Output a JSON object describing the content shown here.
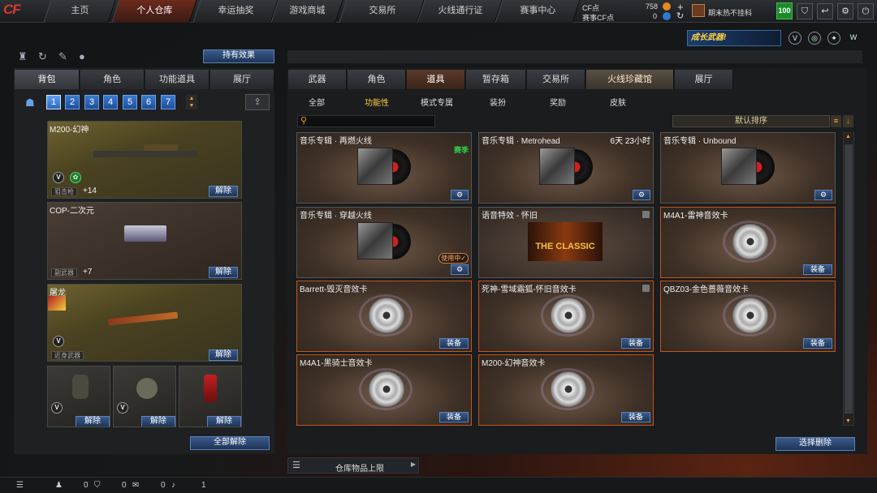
{
  "topnav": {
    "logo": "CF",
    "tabs": [
      "主页",
      "个人仓库",
      "幸运抽奖",
      "游戏商城",
      "交易所",
      "火线通行证",
      "赛事中心"
    ],
    "active_tab": 1,
    "cf_label": "CF点",
    "cf_value": "758",
    "tradecf_label": "赛事CF点",
    "tradecf_value": "0",
    "plus": "+",
    "clan": "期末热不挂科",
    "level": "100"
  },
  "banner": {
    "text": "成长武器!"
  },
  "left": {
    "effect_button": "持有效果",
    "tabs": [
      "背包",
      "角色",
      "功能道具",
      "展厅"
    ],
    "pages": [
      "1",
      "2",
      "3",
      "4",
      "5",
      "6",
      "7"
    ],
    "slots": [
      {
        "name": "M200-幻神",
        "type": "狙击枪",
        "bonus": "+14",
        "button": "解除"
      },
      {
        "name": "COP-二次元",
        "type": "副武器",
        "bonus": "+7",
        "button": "解除"
      },
      {
        "name": "屠龙",
        "type": "近身武器",
        "bonus": "",
        "button": "解除"
      }
    ],
    "grenades": [
      {
        "button": "解除"
      },
      {
        "button": "解除"
      },
      {
        "button": "解除"
      }
    ],
    "unequip_all": "全部解除"
  },
  "right": {
    "tabs": [
      "武器",
      "角色",
      "道具",
      "暂存箱",
      "交易所",
      "火线珍藏馆",
      "展厅"
    ],
    "active_tab": 2,
    "selected_tab": 5,
    "subtabs": [
      "全部",
      "功能性",
      "模式专属",
      "装扮",
      "奖励",
      "皮肤"
    ],
    "active_subtab": 1,
    "sort": "默认排序",
    "cards": [
      {
        "name": "音乐专辑 · 再燃火线",
        "kind": "album",
        "tag": "赛季",
        "tag_color": "#2fd04a",
        "button": "⚙"
      },
      {
        "name": "音乐专辑 · Metrohead",
        "kind": "album",
        "tag": "6天 23小时",
        "tag_color": "#ffffff",
        "button": "⚙"
      },
      {
        "name": "音乐专辑 · Unbound",
        "kind": "album",
        "tag": "",
        "button": "⚙"
      },
      {
        "name": "音乐专辑 · 穿越火线",
        "kind": "album",
        "tag": "使用中✓",
        "tag_color": "#ffb070",
        "button": "⚙"
      },
      {
        "name": "语音特效 - 怀旧",
        "kind": "classic",
        "art": "THE CLASSIC",
        "tag": "",
        "button": ""
      },
      {
        "name": "M4A1-雷神音效卡",
        "kind": "disc",
        "tag": "",
        "button": "装备"
      },
      {
        "name": "Barrett-毁灭音效卡",
        "kind": "disc",
        "tag": "",
        "button": "装备"
      },
      {
        "name": "死神-雪域霜狐-怀旧音效卡",
        "kind": "disc",
        "tag": "",
        "button": "装备"
      },
      {
        "name": "QBZ03-金色蔷薇音效卡",
        "kind": "disc",
        "tag": "",
        "button": "装备"
      },
      {
        "name": "M4A1-黑骑士音效卡",
        "kind": "disc",
        "tag": "",
        "button": "装备"
      },
      {
        "name": "M200-幻神音效卡",
        "kind": "disc",
        "tag": "",
        "button": "装备"
      }
    ],
    "select_delete": "选择删除",
    "storage_limit": "仓库物品上限"
  },
  "bottombar": {
    "values": [
      "0",
      "0",
      "0",
      "1"
    ]
  },
  "colors": {
    "accent_orange": "#c4541c",
    "button_blue": "#2a4a78",
    "active_tab": "#6b2a1c"
  }
}
